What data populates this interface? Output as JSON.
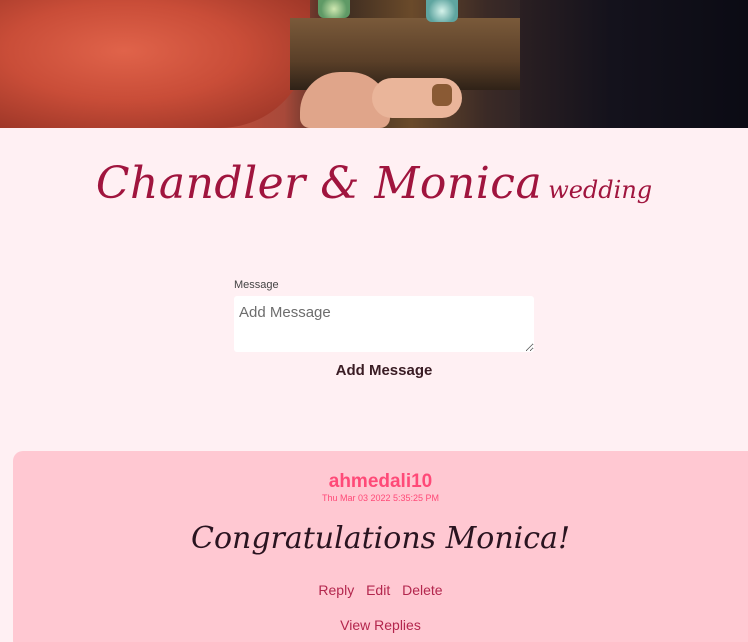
{
  "header": {
    "title_names": "Chandler & Monica",
    "title_suffix": "wedding"
  },
  "form": {
    "label": "Message",
    "placeholder": "Add Message",
    "submit_label": "Add Message"
  },
  "comments": [
    {
      "author": "ahmedali10",
      "date": "Thu Mar 03 2022 5:35:25 PM",
      "message": "Congratulations Monica!",
      "actions": [
        "Reply",
        "Edit",
        "Delete"
      ],
      "view_replies": "View Replies"
    }
  ],
  "colors": {
    "page_bg": "#fff0f3",
    "accent": "#a0153e",
    "card_bg": "#ffc8d2",
    "author": "#ff4a78",
    "link": "#b3264d"
  }
}
